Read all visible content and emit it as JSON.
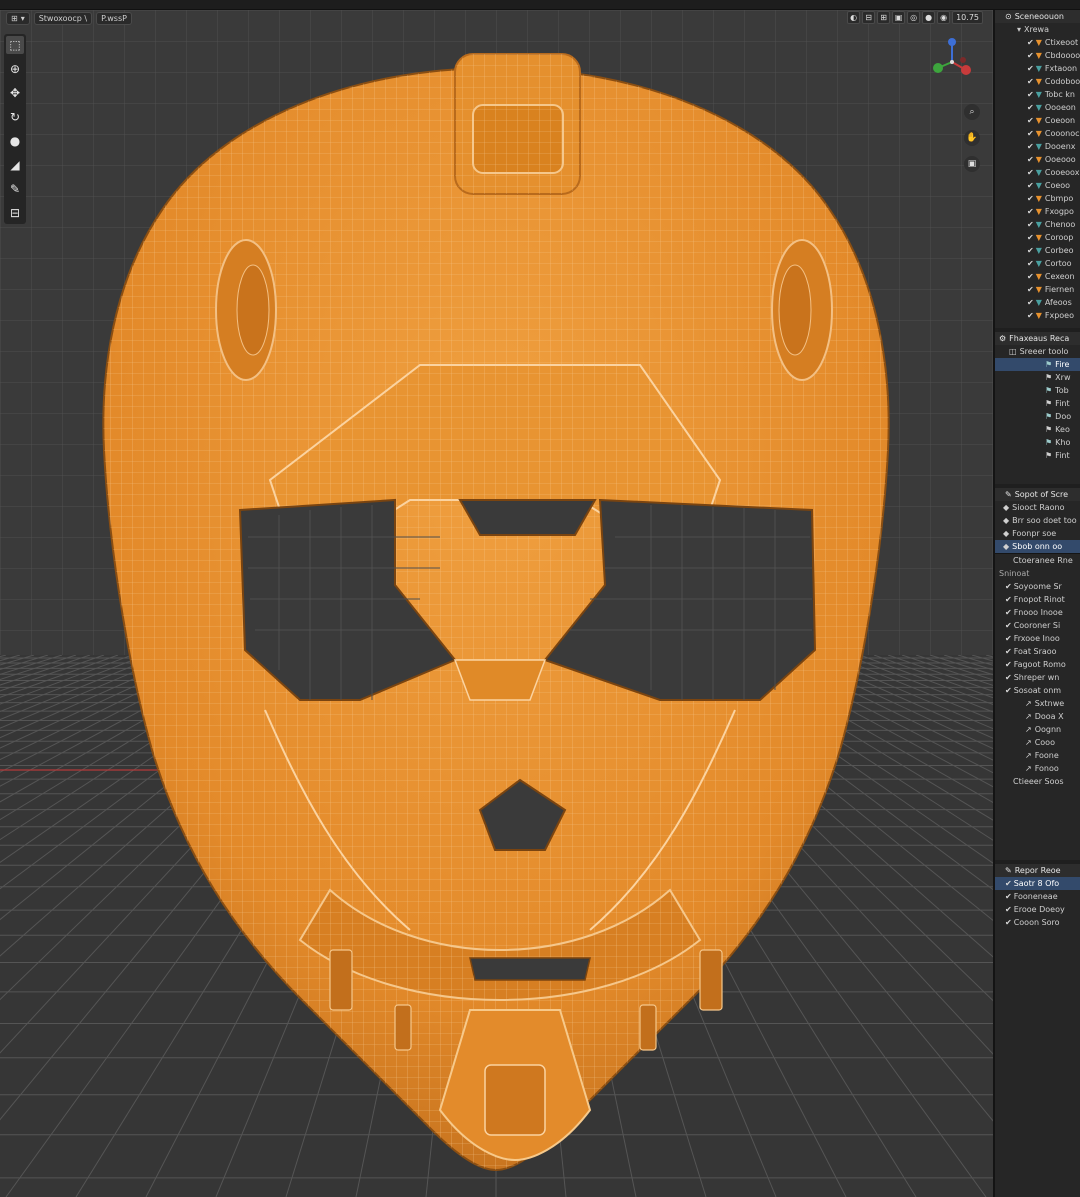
{
  "app": {
    "colors": {
      "mesh_fill": "#e8922e",
      "mesh_wire": "#f7c98a",
      "grid_bg": "#3a3a3a",
      "grid_line": "#505050",
      "axis_red": "#b33a3a",
      "selection_blue": "#334a6b"
    }
  },
  "viewport": {
    "header": {
      "mode_label": "Stwoxoocp \\",
      "mode2_label": "P.wssP",
      "view_value": "10.75"
    },
    "toolbar": [
      {
        "icon": "select-box-icon",
        "glyph": "⬚"
      },
      {
        "icon": "cursor-icon",
        "glyph": "⊕"
      },
      {
        "icon": "move-icon",
        "glyph": "✥"
      },
      {
        "icon": "rotate-icon",
        "glyph": "↻"
      },
      {
        "icon": "scale-icon",
        "glyph": "●"
      },
      {
        "icon": "transform-icon",
        "glyph": "◢"
      },
      {
        "icon": "annotate-icon",
        "glyph": "✎"
      },
      {
        "icon": "measure-icon",
        "glyph": "⊟"
      }
    ],
    "gizmo": {
      "x_label": "X",
      "y_label": "Y",
      "z_label": "Z"
    },
    "nav_buttons": [
      {
        "icon": "zoom-icon",
        "glyph": "⌕"
      },
      {
        "icon": "pan-hand-icon",
        "glyph": "✋"
      },
      {
        "icon": "camera-icon",
        "glyph": "▣"
      }
    ]
  },
  "outliner": {
    "header": "Sceneoouon",
    "collection": "Xrewa",
    "items": [
      "Ctixeoot",
      "Cbdoooo",
      "Fxtaoon",
      "Codoboo",
      "Tobc kn",
      "Oooeon",
      "Coeoon",
      "Cooonoc",
      "Dooenx",
      "Ooeooo",
      "Cooeoox",
      "Coeoo",
      "Cbmpo",
      "Fxogpo",
      "Chenoo",
      "Coroop",
      "Corbeo",
      "Cortoo",
      "Cexeon",
      "Fiernen",
      "Afeoos",
      "Fxpoeo"
    ]
  },
  "properties": {
    "header": "Fhaxeaus Reca",
    "sub_header": "Sreeer toolo",
    "items": [
      "Fire",
      "Xrw",
      "Tob",
      "Fint",
      "Doo",
      "Keo",
      "Kho",
      "Fint"
    ]
  },
  "modifiers": {
    "header": "Sopot of Scre",
    "rows": [
      "Siooct Raono",
      "Brr soo doet too",
      "Foonpr soe",
      "Sbob onn oo"
    ],
    "section_label": "Ctoeranee Rne",
    "section_sub": "Sninoat",
    "entries": [
      "Soyoome Sr",
      "Fnopot Rinot",
      "Fnooo Inooe",
      "Cooroner Si",
      "Frxooe Inoo",
      "Foat Sraoo",
      "Fagoot Romo",
      "Shreper wn",
      "Sosoat onm"
    ],
    "sub_entries": [
      "Sxtnwe",
      "Dooa X",
      "Oognn",
      "Cooo",
      "Foone",
      "Fonoo"
    ],
    "footer": "Ctieeer Soos"
  },
  "materials": {
    "header": "Repor Reoe",
    "items": [
      "Saotr 8 Ofo",
      "Fooneneae",
      "Erooe Doeoy",
      "Cooon Soro"
    ]
  }
}
